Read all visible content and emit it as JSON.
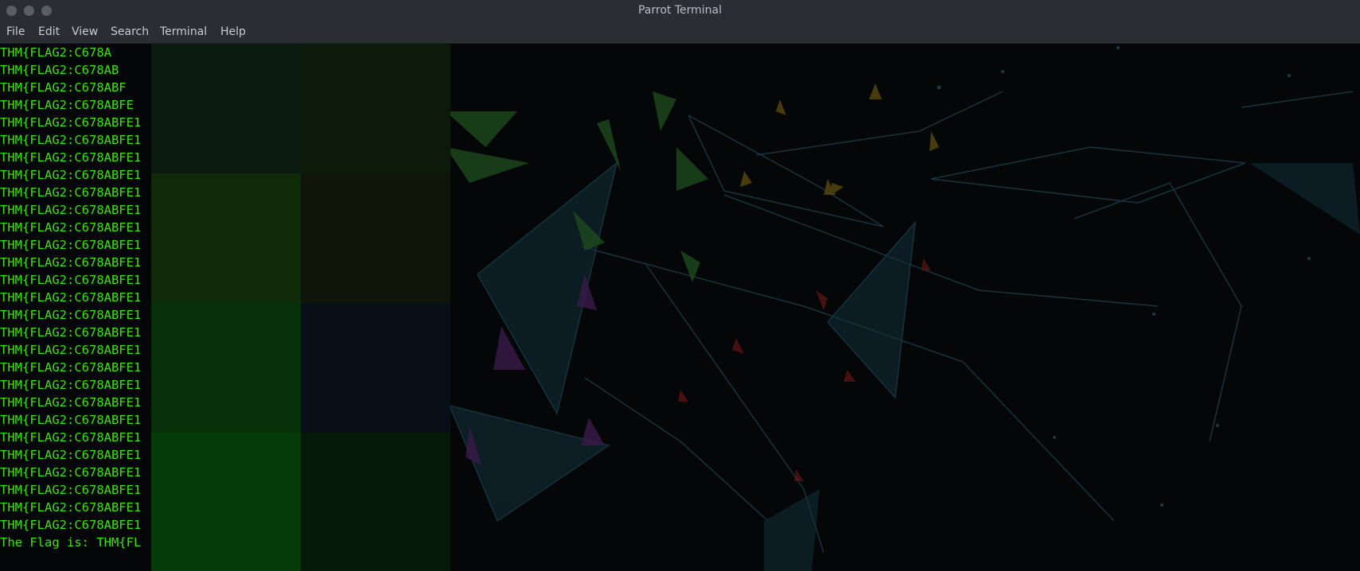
{
  "window": {
    "title": "Parrot Terminal"
  },
  "menu": [
    "File",
    "Edit",
    "View",
    "Search",
    "Terminal",
    "Help"
  ],
  "terminal": {
    "text_color": "#39e600",
    "lines": [
      "THM{FLAG2:C678A",
      "THM{FLAG2:C678AB",
      "THM{FLAG2:C678ABF",
      "THM{FLAG2:C678ABFE",
      "THM{FLAG2:C678ABFE1",
      "THM{FLAG2:C678ABFE1",
      "THM{FLAG2:C678ABFE1",
      "THM{FLAG2:C678ABFE1",
      "THM{FLAG2:C678ABFE1",
      "THM{FLAG2:C678ABFE1",
      "THM{FLAG2:C678ABFE1",
      "THM{FLAG2:C678ABFE1",
      "THM{FLAG2:C678ABFE1",
      "THM{FLAG2:C678ABFE1",
      "THM{FLAG2:C678ABFE1",
      "THM{FLAG2:C678ABFE1",
      "THM{FLAG2:C678ABFE1",
      "THM{FLAG2:C678ABFE1",
      "THM{FLAG2:C678ABFE1",
      "THM{FLAG2:C678ABFE1",
      "THM{FLAG2:C678ABFE1",
      "THM{FLAG2:C678ABFE1",
      "THM{FLAG2:C678ABFE1",
      "THM{FLAG2:C678ABFE1",
      "THM{FLAG2:C678ABFE1",
      "THM{FLAG2:C678ABFE1",
      "THM{FLAG2:C678ABFE1",
      "THM{FLAG2:C678ABFE1",
      "The Flag is: THM{FL"
    ]
  },
  "redaction_colors": [
    "#0a1a0e",
    "#0c1a0a",
    "#0f2a08",
    "#101509",
    "#073109",
    "#080f18",
    "#053b08",
    "#071a0a"
  ]
}
